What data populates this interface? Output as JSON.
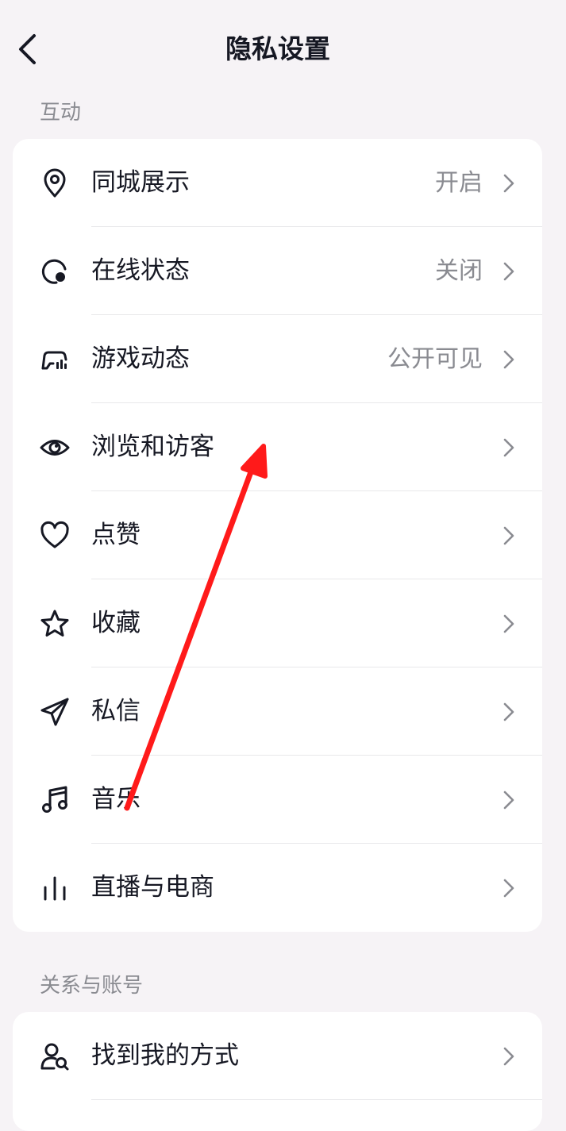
{
  "header": {
    "title": "隐私设置",
    "back_icon": "chevron-left-icon"
  },
  "sections": [
    {
      "label": "互动",
      "items": [
        {
          "icon": "location-pin-icon",
          "label": "同城展示",
          "value": "开启"
        },
        {
          "icon": "online-status-icon",
          "label": "在线状态",
          "value": "关闭"
        },
        {
          "icon": "game-controller-icon",
          "label": "游戏动态",
          "value": "公开可见"
        },
        {
          "icon": "eye-icon",
          "label": "浏览和访客",
          "value": ""
        },
        {
          "icon": "heart-icon",
          "label": "点赞",
          "value": ""
        },
        {
          "icon": "star-icon",
          "label": "收藏",
          "value": ""
        },
        {
          "icon": "paper-plane-icon",
          "label": "私信",
          "value": ""
        },
        {
          "icon": "music-note-icon",
          "label": "音乐",
          "value": ""
        },
        {
          "icon": "live-bars-icon",
          "label": "直播与电商",
          "value": ""
        }
      ]
    },
    {
      "label": "关系与账号",
      "items": [
        {
          "icon": "user-search-icon",
          "label": "找到我的方式",
          "value": ""
        }
      ]
    }
  ],
  "colors": {
    "background": "#f6f3f6",
    "card": "#ffffff",
    "text_primary": "#161823",
    "text_secondary": "#8a8b91",
    "annotation_arrow": "#ff1a1a"
  }
}
